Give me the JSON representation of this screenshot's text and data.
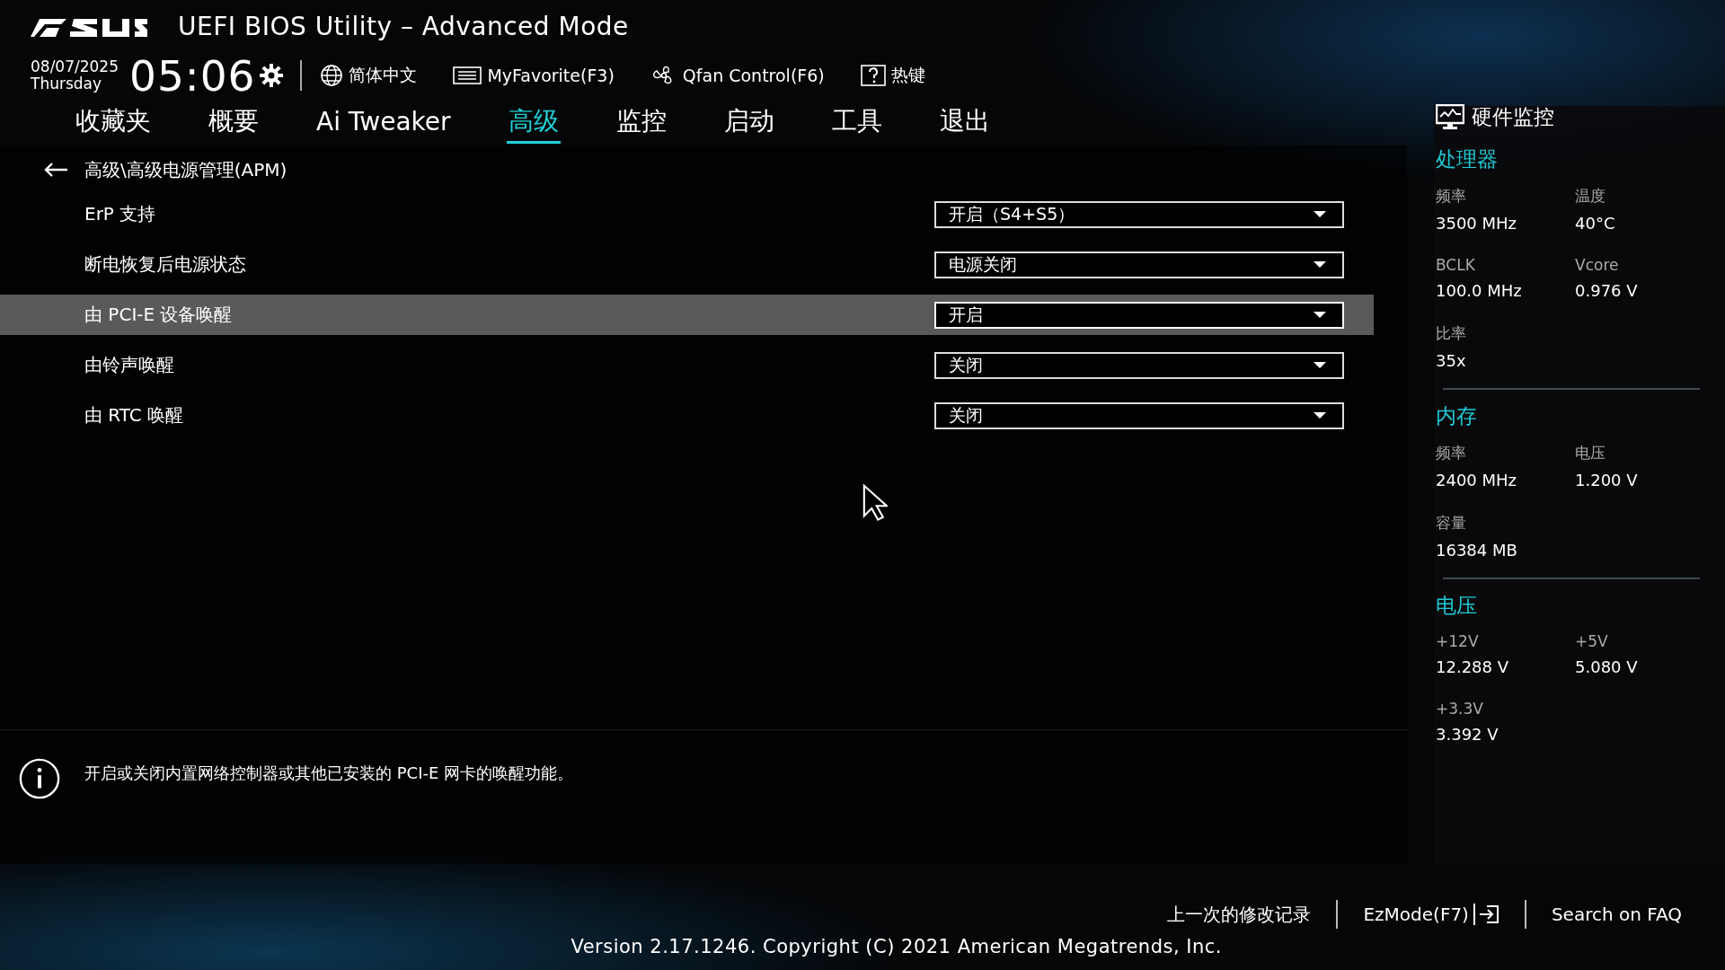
{
  "header": {
    "title": "UEFI BIOS Utility – Advanced Mode",
    "date": "08/07/2025",
    "weekday": "Thursday",
    "time": "05:06",
    "tools": [
      {
        "kind": "language",
        "label": "简体中文"
      },
      {
        "kind": "favorite",
        "label": "MyFavorite(F3)"
      },
      {
        "kind": "fan",
        "label": "Qfan Control(F6)"
      },
      {
        "kind": "help",
        "label": "热键"
      }
    ]
  },
  "tabs": [
    {
      "label": "收藏夹",
      "selected": false
    },
    {
      "label": "概要",
      "selected": false
    },
    {
      "label": "Ai Tweaker",
      "selected": false
    },
    {
      "label": "高级",
      "selected": true
    },
    {
      "label": "监控",
      "selected": false
    },
    {
      "label": "启动",
      "selected": false
    },
    {
      "label": "工具",
      "selected": false
    },
    {
      "label": "退出",
      "selected": false
    }
  ],
  "breadcrumb": "高级\\高级电源管理(APM)",
  "settings": [
    {
      "label": "ErP 支持",
      "value": "开启（S4+S5）",
      "selected": false
    },
    {
      "label": "断电恢复后电源状态",
      "value": "电源关闭",
      "selected": false
    },
    {
      "label": "由 PCI-E 设备唤醒",
      "value": "开启",
      "selected": true
    },
    {
      "label": "由铃声唤醒",
      "value": "关闭",
      "selected": false
    },
    {
      "label": "由 RTC 唤醒",
      "value": "关闭",
      "selected": false
    }
  ],
  "help_text": "开启或关闭内置网络控制器或其他已安装的 PCI-E 网卡的唤醒功能。",
  "hardware_monitor": {
    "title": "硬件监控",
    "sections": [
      {
        "title": "处理器",
        "items": [
          {
            "label": "频率",
            "value": "3500 MHz"
          },
          {
            "label": "温度",
            "value": "40°C"
          },
          {
            "label": "BCLK",
            "value": "100.0 MHz"
          },
          {
            "label": "Vcore",
            "value": "0.976 V"
          },
          {
            "label": "比率",
            "value": "35x"
          }
        ]
      },
      {
        "title": "内存",
        "items": [
          {
            "label": "频率",
            "value": "2400 MHz"
          },
          {
            "label": "电压",
            "value": "1.200 V"
          },
          {
            "label": "容量",
            "value": "16384 MB"
          }
        ]
      },
      {
        "title": "电压",
        "items": [
          {
            "label": "+12V",
            "value": "12.288 V"
          },
          {
            "label": "+5V",
            "value": "5.080 V"
          },
          {
            "label": "+3.3V",
            "value": "3.392 V"
          }
        ]
      }
    ]
  },
  "footer": {
    "links": [
      {
        "kind": "history",
        "label": "上一次的修改记录"
      },
      {
        "kind": "ezmode",
        "label": "EzMode(F7)"
      },
      {
        "kind": "search",
        "label": "Search on FAQ"
      }
    ],
    "version": "Version 2.17.1246. Copyright (C) 2021 American Megatrends, Inc."
  }
}
